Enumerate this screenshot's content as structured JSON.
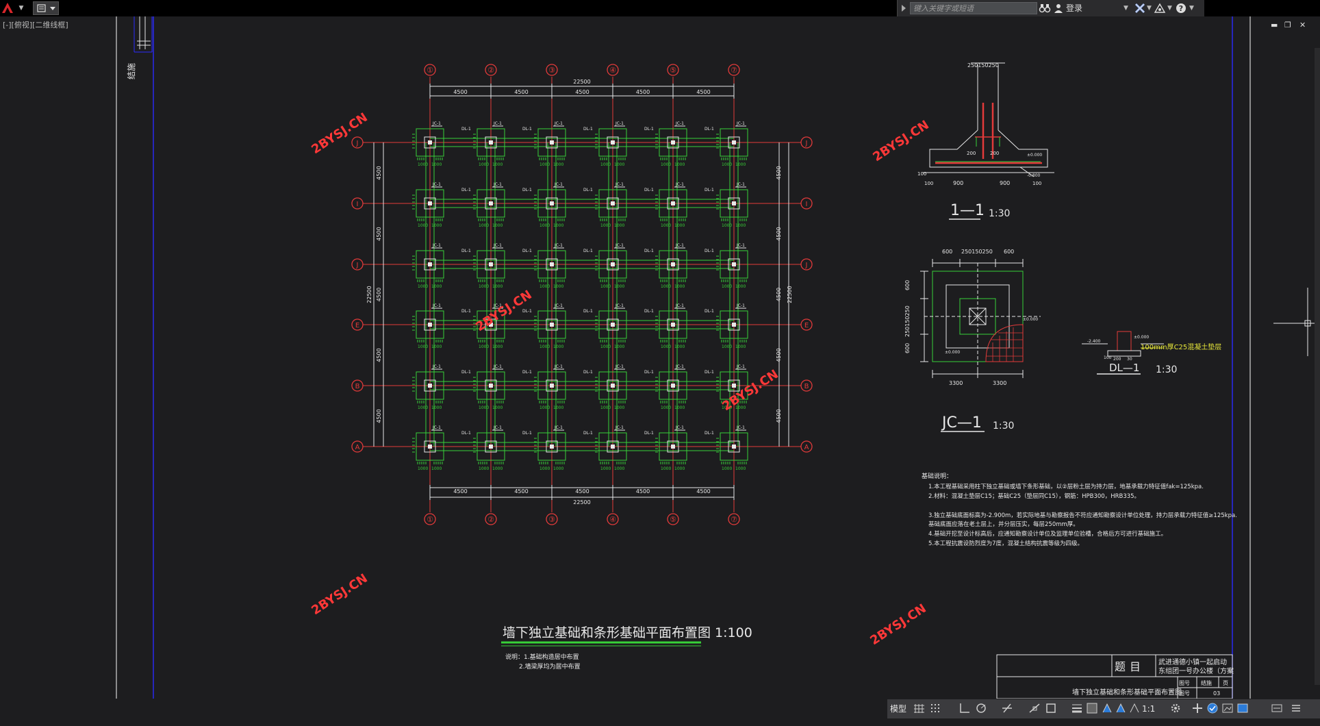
{
  "app": {
    "viewport_label": "[-][俯视][二维线框]",
    "search_placeholder": "键入关键字或短语",
    "login_label": "登录"
  },
  "colors": {
    "background": "#1d1d1f",
    "axis_red": "#e23a3a",
    "foundation_green": "#38d138",
    "dimension_white": "#e8e8e8",
    "detail_yellow": "#e8e83a",
    "watermark_red": "#ff3838"
  },
  "drawing": {
    "watermark": "2BYSJ.CN",
    "grid_top": [
      "①",
      "②",
      "③",
      "④",
      "⑤",
      "⑦"
    ],
    "grid_side": [
      "J",
      "I",
      "J",
      "E",
      "B",
      "A"
    ],
    "span": "4500",
    "total": "22500",
    "pad_dim": "1000",
    "jc_label": "JC-1",
    "dl_label": "DL-1",
    "main_title": "墙下独立基础和条形基础平面布置图 1:100",
    "notes": [
      "说明：1.基础构造居中布置",
      "2.墙梁厚均为居中布置"
    ],
    "section11": {
      "title": "1—1",
      "scale": "1:30",
      "dim_top": "250150250",
      "dim_mid": [
        "200",
        "200"
      ],
      "dim_bottom": [
        "100",
        "900",
        "900",
        "100"
      ],
      "dim_left": "100",
      "callouts": [
        "±0.000",
        "-0.800"
      ]
    },
    "jc1": {
      "title": "JC—1",
      "scale": "1:30",
      "dim_top": [
        "600",
        "250150250",
        "600"
      ],
      "dim_left": [
        "600",
        "250150250",
        "600"
      ],
      "dim_bottom": [
        "3300",
        "3300"
      ],
      "callouts": [
        "±0.000",
        "±0.000"
      ]
    },
    "dl1": {
      "title": "DL—1",
      "scale": "1:30",
      "note": "100mm厚C25混凝土垫层",
      "dims": [
        "200",
        "30",
        "100",
        "-2.400",
        "±0.000"
      ]
    },
    "foundation_notes": {
      "heading": "基础说明：",
      "lines": [
        "1.本工程基础采用柱下独立基础或墙下条形基础，以②层粉土层为持力层，地基承载力特征值fak=125kpa.",
        "2.材料：混凝土垫层C15；基础C25（垫层同C15），钢筋：HPB300，HRB335。",
        "3.独立基础底面标高为-2.900m，若实际地基与勘察报告不符应通知勘察设计单位处理，持力层承载力特征值≥125kpa.",
        "   基础底面应落在老土层上，并分层压实，每层250mm厚。",
        "4.基础开挖至设计标高后，应通知勘察设计单位及监理单位验槽，合格后方可进行基础施工。",
        "5.本工程抗震设防烈度为7度，混凝土结构抗震等级为四级。"
      ]
    },
    "title_block": {
      "label": "题目",
      "project_line1": "武进通德小镇一起启动",
      "project_line2": "东组团一号办公楼（方案",
      "drawing_name": "墙下独立基础和条形基础平面布置图",
      "row1": [
        "图号",
        "结施",
        "页"
      ],
      "row2": [
        "图号",
        "03"
      ]
    },
    "side_label": "结施"
  },
  "statusbar": {
    "model_label": "模型",
    "scale": "1:1"
  }
}
